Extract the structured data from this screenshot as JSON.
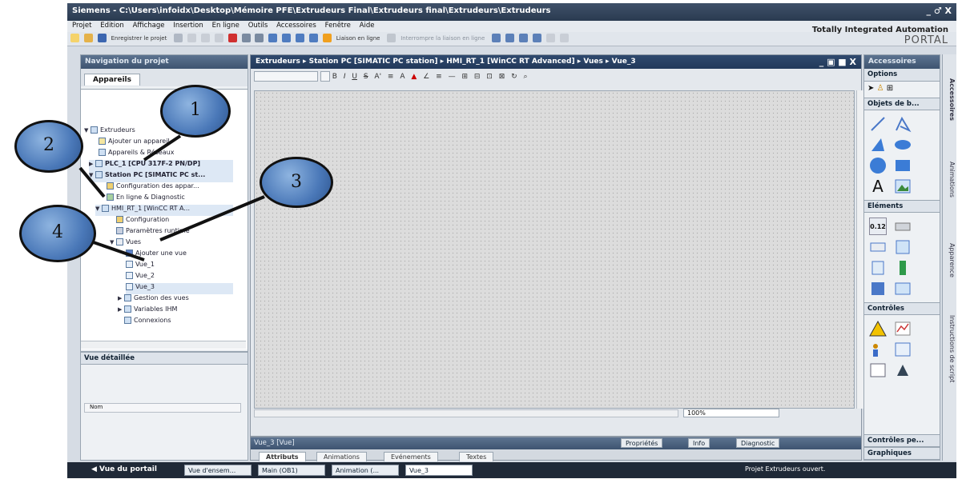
{
  "window": {
    "title": "Siemens - C:\\Users\\infoidx\\Desktop\\Mémoire PFE\\Extrudeurs Final\\Extrudeurs final\\Extrudeurs\\Extrudeurs",
    "controls": "_ ♂ X"
  },
  "menu": [
    "Projet",
    "Edition",
    "Affichage",
    "Insertion",
    "En ligne",
    "Outils",
    "Accessoires",
    "Fenêtre",
    "Aide"
  ],
  "toolbar": {
    "save_label": "Enregistrer le projet",
    "online_label": "Liaison en ligne",
    "offline_label": "Interrompre la liaison en ligne"
  },
  "brand": {
    "line1": "Totally Integrated Automation",
    "line2": "PORTAL"
  },
  "project_nav": {
    "header": "Navigation du projet",
    "tab": "Appareils",
    "tree": [
      "Extrudeurs",
      "Ajouter un appareil",
      "Appareils & Réseaux",
      "PLC_1 [CPU 317F-2 PN/DP]",
      "Station PC [SIMATIC PC st...",
      "Configuration des appar...",
      "En ligne & Diagnostic",
      "HMI_RT_1 [WinCC RT A...",
      "Configuration",
      "Paramètres runtime",
      "Vues",
      "Ajouter une vue",
      "Vue_1",
      "Vue_2",
      "Vue_3",
      "Gestion des vues",
      "Variables IHM",
      "Connexions"
    ],
    "detail_header": "Vue détaillée",
    "detail_col": "Nom"
  },
  "editor": {
    "breadcrumb": "Extrudeurs ▸ Station PC [SIMATIC PC station] ▸ HMI_RT_1 [WinCC RT Advanced] ▸ Vues ▸ Vue_3",
    "zoom": "100%"
  },
  "properties": {
    "title": "Vue_3 [Vue]",
    "tabs": [
      "Propriétés",
      "Info",
      "Diagnostic"
    ],
    "subtabs": [
      "Attributs",
      "Animations",
      "Evénements",
      "Textes"
    ]
  },
  "toolbox": {
    "header": "Accessoires",
    "options": "Options",
    "sections": [
      "Objets de b...",
      "Eléments",
      "Contrôles",
      "Contrôles pe...",
      "Graphiques"
    ],
    "text_tool": "A",
    "element_label": "0.12"
  },
  "side_tabs": [
    "Accessoires",
    "Animations",
    "Apparence",
    "Instructions de script"
  ],
  "taskbar": {
    "portal": "◀ Vue du portail",
    "items": [
      "Vue d'ensem...",
      "Main (OB1)",
      "Animation (...",
      "Vue_3"
    ],
    "status": "Projet Extrudeurs ouvert."
  },
  "callouts": [
    "1",
    "2",
    "3",
    "4"
  ]
}
